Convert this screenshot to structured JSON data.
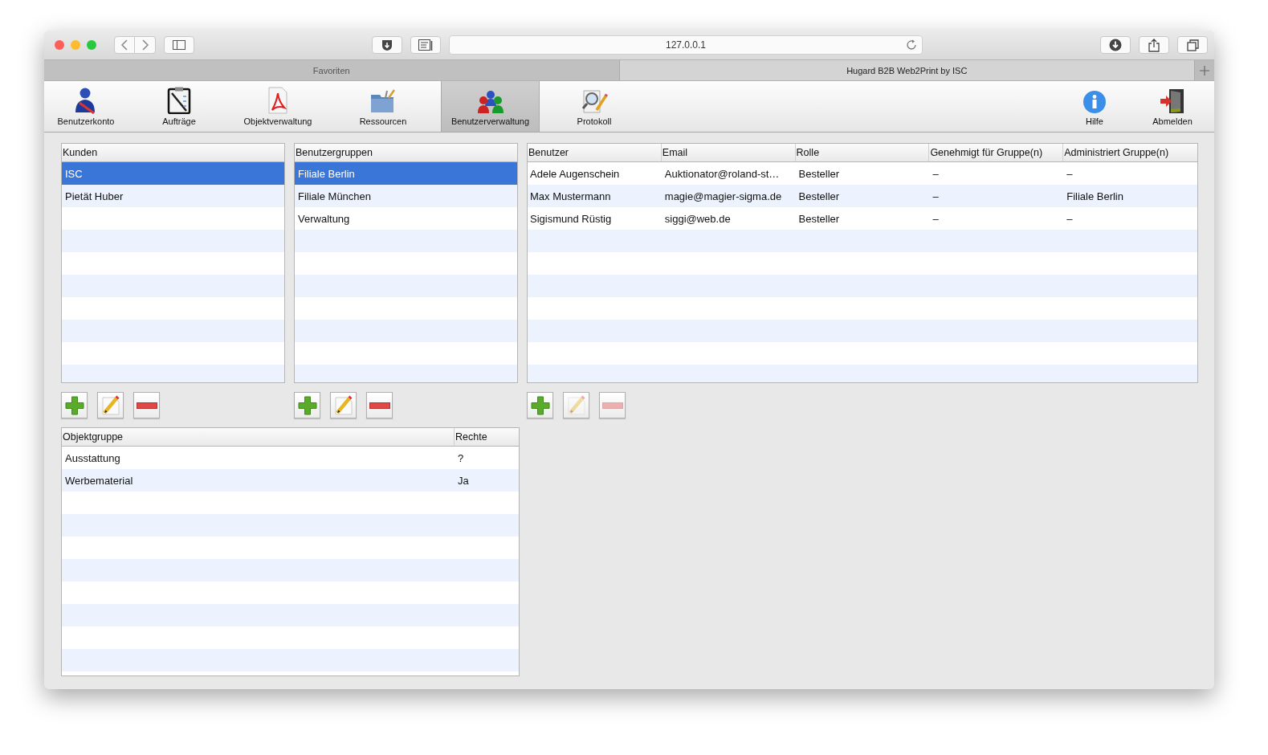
{
  "browser": {
    "address": "127.0.0.1",
    "tabs": [
      {
        "label": "Favoriten",
        "selected": false
      },
      {
        "label": "Hugard B2B Web2Print by ISC",
        "selected": true
      }
    ]
  },
  "toolbar": {
    "left": [
      {
        "label": "Benutzerkonto",
        "selected": false
      },
      {
        "label": "Aufträge",
        "selected": false
      },
      {
        "label": "Objektverwaltung",
        "selected": false
      },
      {
        "label": "Ressourcen",
        "selected": false
      },
      {
        "label": "Benutzerverwaltung",
        "selected": true
      },
      {
        "label": "Protokoll",
        "selected": false
      }
    ],
    "right": [
      {
        "label": "Hilfe",
        "selected": false
      },
      {
        "label": "Abmelden",
        "selected": false
      }
    ]
  },
  "customers": {
    "columns": [
      "Kunden"
    ],
    "rows": [
      {
        "cells": [
          "ISC"
        ],
        "selected": true
      },
      {
        "cells": [
          "Pietät Huber"
        ],
        "selected": false
      }
    ],
    "actions": [
      {
        "kind": "add",
        "disabled": false
      },
      {
        "kind": "edit",
        "disabled": false
      },
      {
        "kind": "remove",
        "disabled": false
      }
    ]
  },
  "user_groups": {
    "columns": [
      "Benutzergruppen"
    ],
    "rows": [
      {
        "cells": [
          "Filiale Berlin"
        ],
        "selected": true
      },
      {
        "cells": [
          "Filiale München"
        ],
        "selected": false
      },
      {
        "cells": [
          "Verwaltung"
        ],
        "selected": false
      }
    ],
    "actions": [
      {
        "kind": "add",
        "disabled": false
      },
      {
        "kind": "edit",
        "disabled": false
      },
      {
        "kind": "remove",
        "disabled": false
      }
    ]
  },
  "users": {
    "columns": [
      "Benutzer",
      "Email",
      "Rolle",
      "Genehmigt für Gruppe(n)",
      "Administriert Gruppe(n)"
    ],
    "rows": [
      {
        "cells": [
          "Adele Augenschein",
          "Auktionator@roland-st…",
          "Besteller",
          "–",
          "–"
        ],
        "selected": false
      },
      {
        "cells": [
          "Max Mustermann",
          "magie@magier-sigma.de",
          "Besteller",
          "–",
          "Filiale Berlin"
        ],
        "selected": false
      },
      {
        "cells": [
          "Sigismund Rüstig",
          "siggi@web.de",
          "Besteller",
          "–",
          "–"
        ],
        "selected": false
      }
    ],
    "actions": [
      {
        "kind": "add",
        "disabled": false
      },
      {
        "kind": "edit",
        "disabled": true
      },
      {
        "kind": "remove",
        "disabled": true
      }
    ]
  },
  "object_groups": {
    "columns": [
      "Objektgruppe",
      "Rechte"
    ],
    "rows": [
      {
        "cells": [
          "Ausstattung",
          "?"
        ],
        "selected": false
      },
      {
        "cells": [
          "Werbematerial",
          "Ja"
        ],
        "selected": false
      }
    ]
  }
}
